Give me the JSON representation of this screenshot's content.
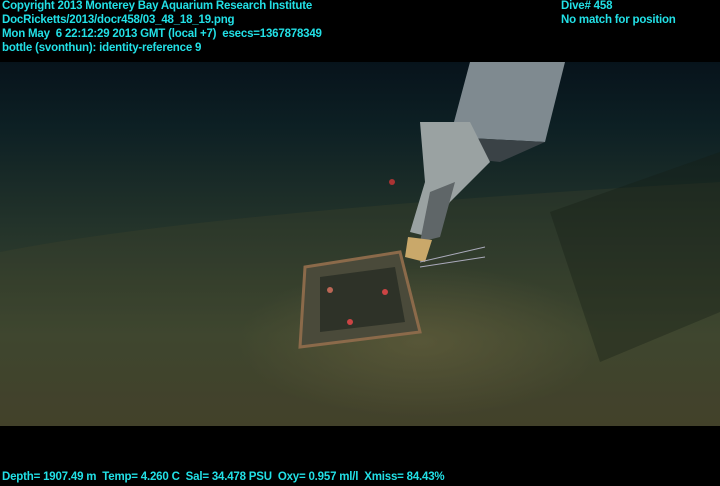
{
  "overlay": {
    "copyright": "Copyright 2013 Monterey Bay Aquarium Research Institute",
    "file": "DocRicketts/2013/docr458/03_48_18_19.png",
    "datetime": "Mon May  6 22:12:29 2013 GMT (local +7)  esecs=1367878349",
    "annotation": "bottle (svonthun): identity-reference 9",
    "dive": "Dive# 458",
    "position": "No match for position",
    "sensors": "Depth= 1907.49 m  Temp= 4.260 C  Sal= 34.478 PSU  Oxy= 0.957 ml/l  Xmiss= 84.43%"
  }
}
